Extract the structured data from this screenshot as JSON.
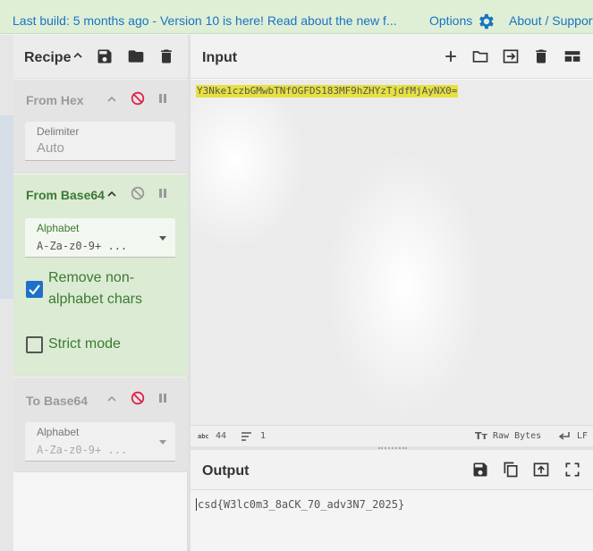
{
  "banner": {
    "message": "Last build: 5 months ago - Version 10 is here! Read about the new f...",
    "options_label": "Options",
    "about_label": "About / Support"
  },
  "recipe": {
    "title": "Recipe",
    "operations": [
      {
        "title": "From Hex",
        "state": "disabled",
        "fields": [
          {
            "label": "Delimiter",
            "value": "Auto"
          }
        ]
      },
      {
        "title": "From Base64",
        "state": "active",
        "fields": [
          {
            "label": "Alphabet",
            "value": "A-Za-z0-9+ ..."
          }
        ],
        "checkboxes": [
          {
            "label": "Remove non-alphabet chars",
            "line1": "Remove non-",
            "line2": "alphabet chars",
            "checked": true
          },
          {
            "label": "Strict mode",
            "checked": false
          }
        ]
      },
      {
        "title": "To Base64",
        "state": "disabled",
        "fields": [
          {
            "label": "Alphabet",
            "value": "A-Za-z0-9+ ..."
          }
        ]
      }
    ]
  },
  "input": {
    "title": "Input",
    "value": "Y3Nke1czbGMwbTNfOGFDS183MF9hZHYzTjdfMjAyNX0=",
    "status": {
      "chars_icon": "abc",
      "chars": "44",
      "lines": "1",
      "format_icon": "Tт",
      "format": "Raw Bytes",
      "eol": "LF"
    }
  },
  "output": {
    "title": "Output",
    "value": "csd{W3lc0m3_8aCK_70_adv3N7_2025}"
  },
  "colors": {
    "banner_bg": "#dfefd6",
    "link": "#1a73c4",
    "active_op_bg": "#dcebd4",
    "active_op_text": "#3a7a32",
    "disable_icon": "#e0204a",
    "checkbox_on": "#1e70c8",
    "highlight": "#e6e040"
  }
}
